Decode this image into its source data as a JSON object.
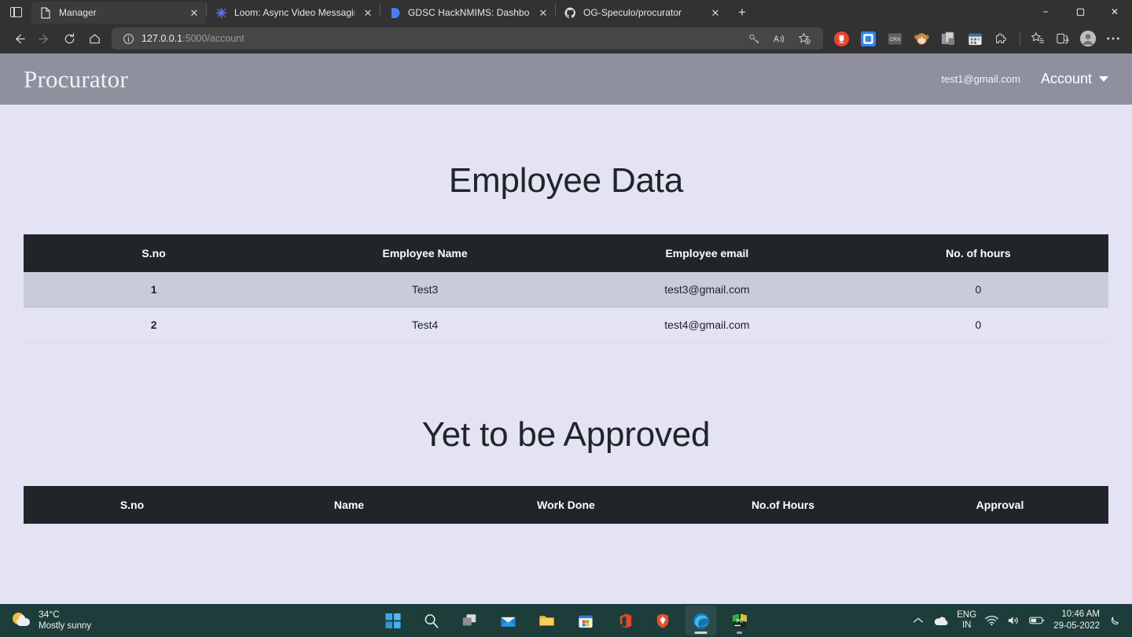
{
  "browser": {
    "sidebar_button": "tab-actions",
    "tabs": [
      {
        "title": "Manager",
        "favicon": "document-icon",
        "active": true
      },
      {
        "title": "Loom: Async Video Messaging fo",
        "favicon": "loom-icon",
        "active": false
      },
      {
        "title": "GDSC HackNMIMS: Dashboard |",
        "favicon": "dashboard-icon",
        "active": false
      },
      {
        "title": "OG-Speculo/procurator",
        "favicon": "github-icon",
        "active": false
      }
    ],
    "new_tab_label": "+",
    "window_controls": {
      "minimize": "−",
      "maximize": "❐",
      "close": "✕"
    },
    "nav": {
      "back": "←",
      "forward": "→",
      "refresh": "↻",
      "home": "⌂"
    },
    "url": {
      "protocol_info": "site-information",
      "host": "127.0.0.1",
      "rest": ":5000/account",
      "full": "127.0.0.1:5000/account"
    },
    "url_actions": [
      "key-icon",
      "read-aloud-icon",
      "add-favorite-icon"
    ],
    "extensions": [
      "brave-shield-icon",
      "screenshot-icon",
      "crx-icon",
      "monkey-icon",
      "collections-copy-icon",
      "calendar-icon",
      "puzzle-icon"
    ],
    "toolbar_right": [
      "favorites-icon",
      "collections-icon",
      "profile-icon",
      "settings-more-icon"
    ]
  },
  "site": {
    "navbar": {
      "brand": "Procurator",
      "email": "test1@gmail.com",
      "account_label": "Account",
      "caret": "chevron-down-icon"
    },
    "sections": [
      {
        "title": "Employee Data",
        "table": {
          "headers": [
            "S.no",
            "Employee Name",
            "Employee email",
            "No. of hours"
          ],
          "rows": [
            [
              "1",
              "Test3",
              "test3@gmail.com",
              "0"
            ],
            [
              "2",
              "Test4",
              "test4@gmail.com",
              "0"
            ]
          ]
        }
      },
      {
        "title": "Yet to be Approved",
        "table": {
          "headers": [
            "S.no",
            "Name",
            "Work Done",
            "No.of Hours",
            "Approval"
          ],
          "rows": []
        }
      }
    ],
    "colors": {
      "navbar_bg": "#8e909e",
      "body_bg": "#e3e3f4",
      "table_header_bg": "#212529",
      "table_stripe_bg": "#c9cbd9",
      "text": "#212529"
    }
  },
  "taskbar": {
    "weather": {
      "temp": "34°C",
      "desc": "Mostly sunny",
      "icon": "sun-cloud-icon"
    },
    "apps": [
      "start-icon",
      "search-icon",
      "task-view-icon",
      "mail-icon",
      "file-explorer-icon",
      "microsoft-store-icon",
      "office-icon",
      "brave-icon",
      "edge-icon",
      "pycharm-icon"
    ],
    "tray": {
      "show_hidden": "chevron-up-icon",
      "cloud": "onedrive-icon",
      "language_line1": "ENG",
      "language_line2": "IN",
      "wifi": "wifi-icon",
      "volume": "speaker-icon",
      "battery": "battery-icon",
      "time": "10:46 AM",
      "date": "29-05-2022",
      "notifications": "moon-icon"
    }
  }
}
